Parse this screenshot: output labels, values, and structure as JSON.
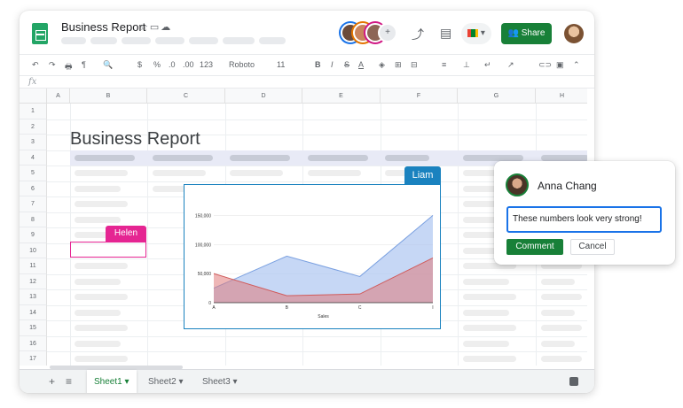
{
  "header": {
    "doc_title": "Business Report",
    "title_icons": [
      "star-icon",
      "folder-move-icon",
      "cloud-status-icon"
    ],
    "share_label": "Share",
    "collaborator_overflow": "+"
  },
  "toolbar": {
    "items": [
      "↶",
      "↷",
      "🖶",
      "¶",
      "🔍",
      "$",
      "%",
      ".0",
      ".00",
      "123",
      "Roboto",
      "11",
      "B",
      "I",
      "S",
      "A"
    ],
    "font_name": "Roboto",
    "font_size": "11",
    "bold": "B",
    "italic": "I",
    "strike": "S",
    "text_color": "A"
  },
  "formula": {
    "fx_label": "fx"
  },
  "columns": [
    "A",
    "B",
    "C",
    "D",
    "E",
    "F",
    "G",
    "H"
  ],
  "rows": [
    "1",
    "2",
    "3",
    "4",
    "5",
    "6",
    "7",
    "8",
    "9",
    "10",
    "11",
    "12",
    "13",
    "14",
    "15",
    "16",
    "17"
  ],
  "sheet": {
    "title": "Business Report"
  },
  "collaborators": {
    "helen": "Helen",
    "liam": "Liam"
  },
  "chart_data": {
    "type": "area",
    "categories": [
      "A",
      "B",
      "C",
      "I"
    ],
    "xlabel": "Sales",
    "ylabel": "",
    "ylim": [
      0,
      175000
    ],
    "yticks": [
      "0",
      "50,000",
      "100,000",
      "150,000"
    ],
    "series": [
      {
        "values": [
          25000,
          80000,
          45000,
          150000
        ],
        "color": "#aec6f1",
        "stroke": "#7aa0e0"
      },
      {
        "values": [
          50000,
          12000,
          15000,
          77000
        ],
        "color": "#e07a7a",
        "stroke": "#d05b5b"
      }
    ]
  },
  "tabs": {
    "add_icon": "+",
    "list_icon": "≡",
    "sheets": [
      {
        "label": "Sheet1",
        "active": true
      },
      {
        "label": "Sheet2",
        "active": false
      },
      {
        "label": "Sheet3",
        "active": false
      }
    ],
    "dropdown": "▾"
  },
  "comment": {
    "author": "Anna Chang",
    "input_value": "These numbers look very strong!",
    "comment_label": "Comment",
    "cancel_label": "Cancel"
  },
  "colors": {
    "accent_green": "#188038",
    "helen": "#e52592",
    "liam": "#1a82bf",
    "focus_blue": "#1a73e8"
  }
}
